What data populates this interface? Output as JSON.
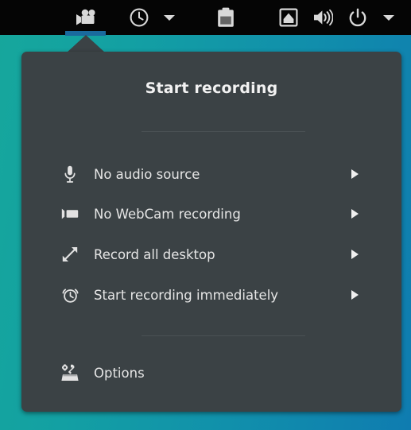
{
  "colors": {
    "desktop_gradient_start": "#16a79c",
    "desktop_gradient_end": "#0f7cb0",
    "topbar_background": "#050505",
    "menu_background": "#3b4245",
    "active_indicator": "#1a6a9e",
    "menu_text": "#e6e6e6",
    "title_text": "#f2f2f2"
  },
  "topbar": {
    "items": [
      {
        "name": "screen-recorder-indicator",
        "icon": "video-camera-icon",
        "label": "",
        "active": true
      },
      {
        "name": "clock-applet",
        "icon": "clock-icon",
        "label": ""
      },
      {
        "name": "clock-applet-dropdown",
        "icon": "chevron-down-icon",
        "label": ""
      },
      {
        "name": "clipboard-applet",
        "icon": "clipboard-icon",
        "label": ""
      },
      {
        "name": "display-applet",
        "icon": "display-icon",
        "label": ""
      },
      {
        "name": "volume-applet",
        "icon": "volume-icon",
        "label": ""
      },
      {
        "name": "power-applet",
        "icon": "power-icon",
        "label": ""
      },
      {
        "name": "power-applet-dropdown",
        "icon": "chevron-down-icon",
        "label": ""
      }
    ]
  },
  "menu": {
    "title": "Start recording",
    "items": [
      {
        "icon": "microphone-icon",
        "label": "No audio source",
        "has_submenu": true
      },
      {
        "icon": "webcam-icon",
        "label": "No WebCam recording",
        "has_submenu": true
      },
      {
        "icon": "expand-arrows-icon",
        "label": "Record all desktop",
        "has_submenu": true
      },
      {
        "icon": "alarm-clock-icon",
        "label": "Start recording immediately",
        "has_submenu": true
      }
    ],
    "footer_items": [
      {
        "icon": "tools-icon",
        "label": "Options",
        "has_submenu": false
      }
    ]
  }
}
